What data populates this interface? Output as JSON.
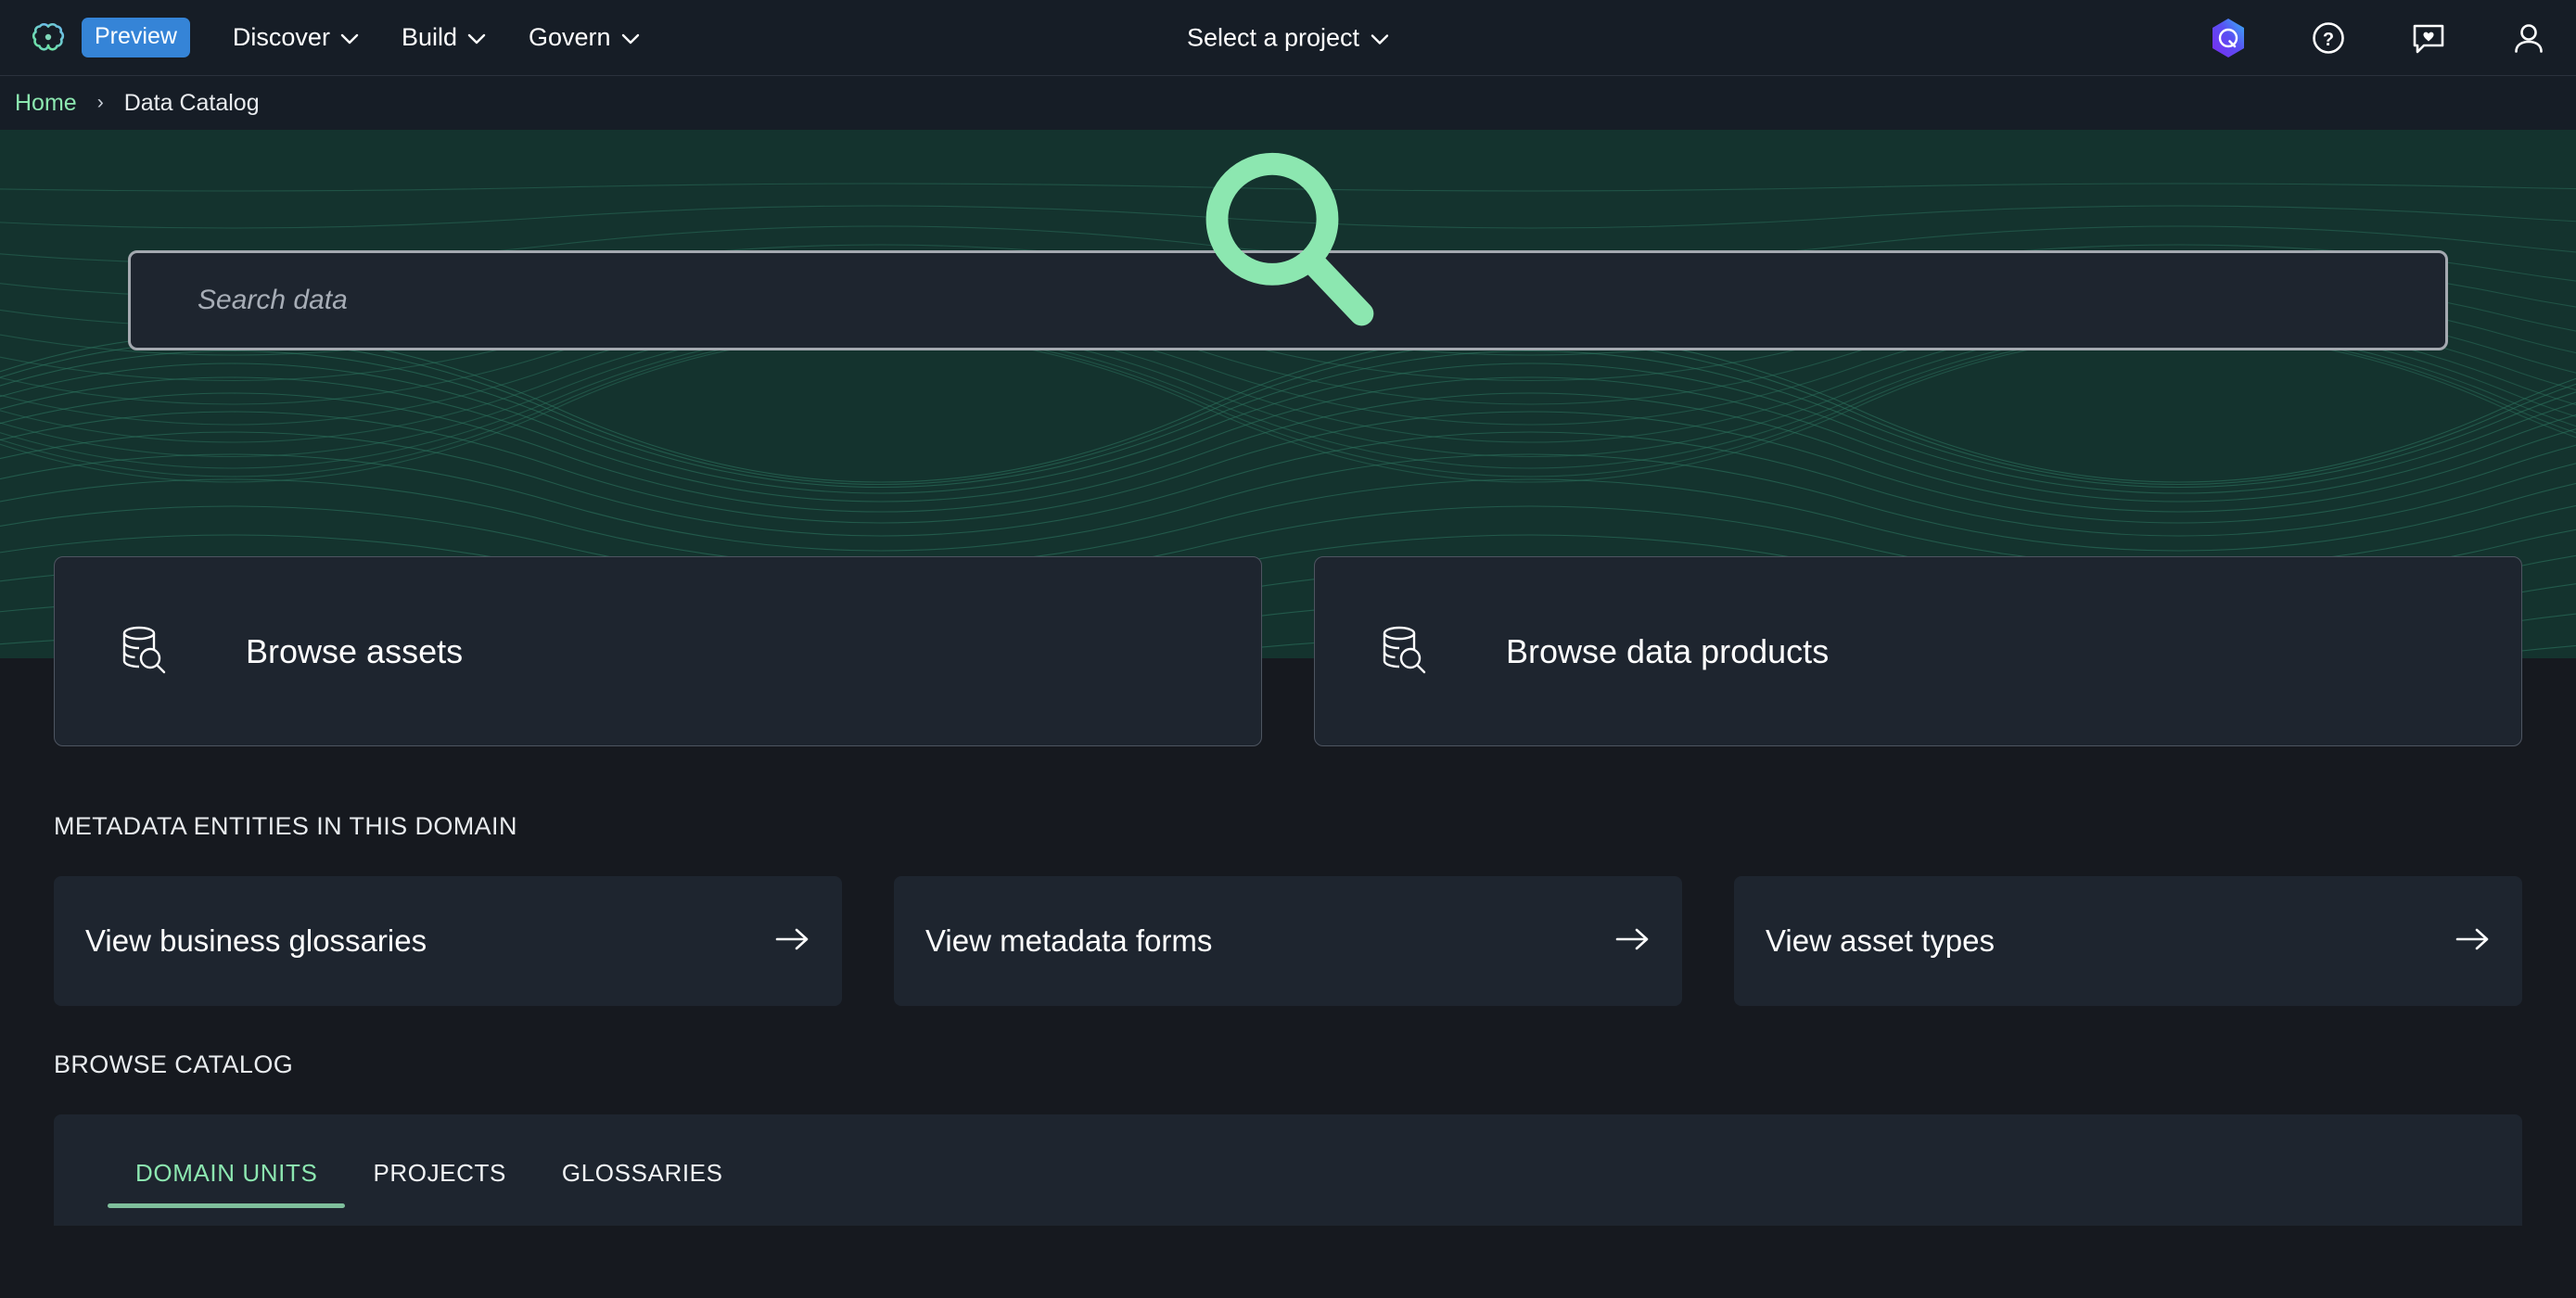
{
  "topnav": {
    "logo_icon": "brain-logo-icon",
    "preview_badge": "Preview",
    "menu": [
      {
        "label": "Discover",
        "icon": "chevron-down-icon"
      },
      {
        "label": "Build",
        "icon": "chevron-down-icon"
      },
      {
        "label": "Govern",
        "icon": "chevron-down-icon"
      }
    ],
    "project_selector": {
      "label": "Select a project",
      "icon": "chevron-down-icon"
    },
    "right_icons": [
      {
        "name": "amazon-q-hexagon-icon"
      },
      {
        "name": "help-circle-icon"
      },
      {
        "name": "feedback-heart-icon"
      },
      {
        "name": "user-profile-icon"
      }
    ]
  },
  "breadcrumb": {
    "home": "Home",
    "separator": "›",
    "current": "Data Catalog"
  },
  "hero": {
    "search": {
      "icon": "search-icon",
      "placeholder": "Search data",
      "value": ""
    }
  },
  "browse_cards": [
    {
      "icon": "database-search-icon",
      "label": "Browse assets"
    },
    {
      "icon": "database-search-icon",
      "label": "Browse data products"
    }
  ],
  "metadata_section": {
    "title": "METADATA ENTITIES IN THIS DOMAIN",
    "cards": [
      {
        "label": "View business glossaries",
        "icon": "arrow-right-icon"
      },
      {
        "label": "View metadata forms",
        "icon": "arrow-right-icon"
      },
      {
        "label": "View asset types",
        "icon": "arrow-right-icon"
      }
    ]
  },
  "browse_catalog": {
    "title": "BROWSE CATALOG",
    "tabs": [
      {
        "label": "DOMAIN UNITS",
        "active": true
      },
      {
        "label": "PROJECTS",
        "active": false
      },
      {
        "label": "GLOSSARIES",
        "active": false
      }
    ]
  },
  "colors": {
    "nav_background": "#161d26",
    "page_background": "#16191f",
    "hero_background": "#14332e",
    "card_background": "#1e252f",
    "accent_green": "#8ce7b0",
    "preview_blue": "#3584d7",
    "tab_underline": "#7fbf9c",
    "card_border": "#4e5561",
    "search_border": "#a4a9b0"
  }
}
